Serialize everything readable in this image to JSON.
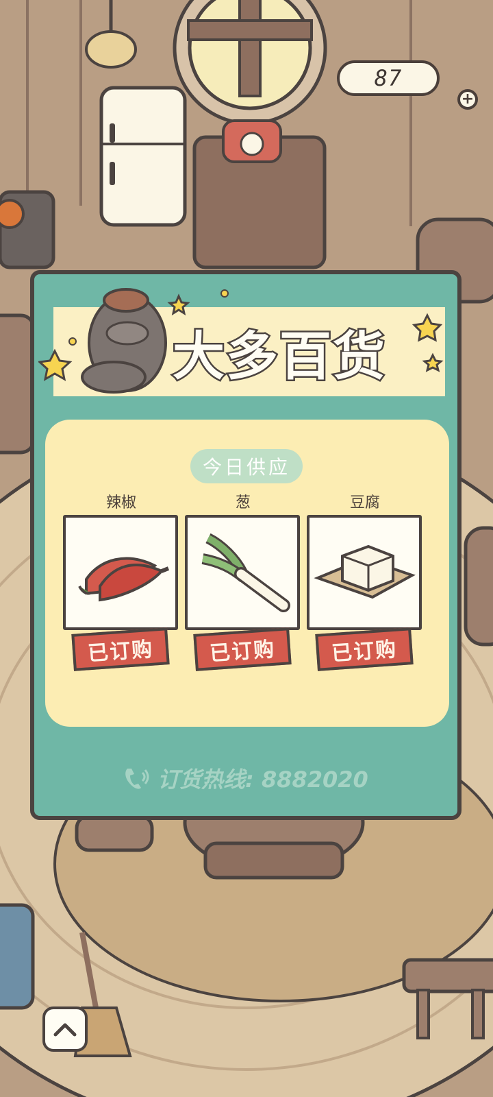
{
  "hud": {
    "coin_count": "87",
    "add_coins_symbol": "+"
  },
  "shop": {
    "title": "大多百货",
    "supply_label": "今日供应",
    "items": [
      {
        "name": "辣椒",
        "status": "已订购",
        "icon": "chili-pepper-icon"
      },
      {
        "name": "葱",
        "status": "已订购",
        "icon": "green-onion-icon"
      },
      {
        "name": "豆腐",
        "status": "已订购",
        "icon": "tofu-icon"
      }
    ],
    "hotline": "订货热线: 8882020"
  },
  "colors": {
    "panel_teal": "#6fb7a6",
    "banner_cream": "#fbf0c4",
    "supply_yellow": "#fcedb3",
    "ordered_tag_red": "#d45a4d",
    "outline": "#4b4340"
  },
  "nav": {
    "expand_icon": "chevron-up-icon"
  }
}
